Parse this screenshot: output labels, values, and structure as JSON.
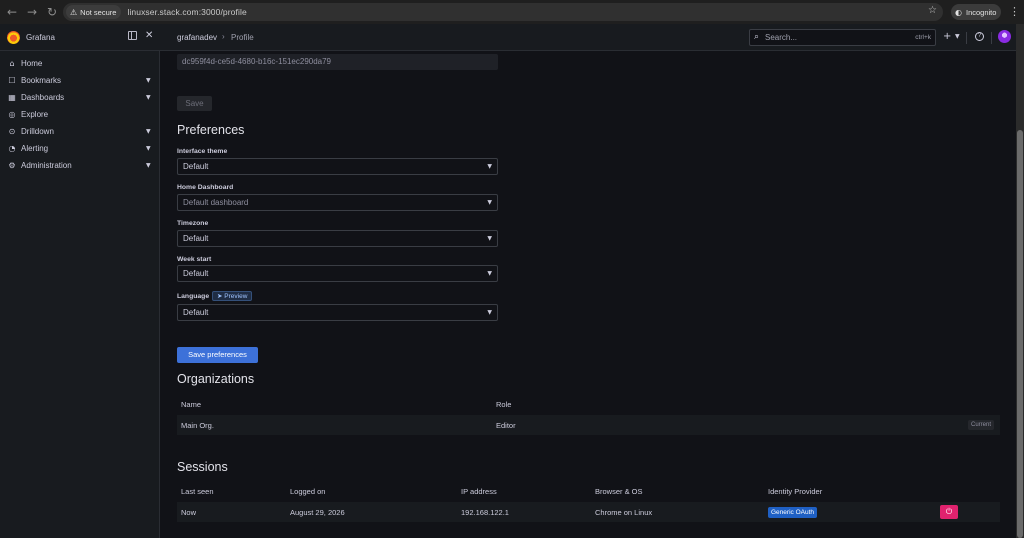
{
  "browser": {
    "back_icon": "arrow-left-icon",
    "forward_icon": "arrow-right-icon",
    "reload_icon": "reload-icon",
    "not_secure_label": "Not secure",
    "url": "linuxser.stack.com:3000/profile",
    "incognito_label": "Incognito"
  },
  "topbar": {
    "brand": "Grafana",
    "breadcrumb_root": "grafanadev",
    "breadcrumb_sep": "›",
    "breadcrumb_current": "Profile",
    "search_placeholder": "Search...",
    "search_shortcut": "ctrl+k",
    "plus_label": "+",
    "help_label": "?"
  },
  "sidebar": {
    "items": [
      {
        "label": "Home",
        "icon": "⌂",
        "has_chevron": false
      },
      {
        "label": "Bookmarks",
        "icon": "☐",
        "has_chevron": true
      },
      {
        "label": "Dashboards",
        "icon": "▦",
        "has_chevron": true
      },
      {
        "label": "Explore",
        "icon": "◎",
        "has_chevron": false
      },
      {
        "label": "Drilldown",
        "icon": "⊙",
        "has_chevron": true
      },
      {
        "label": "Alerting",
        "icon": "◔",
        "has_chevron": true
      },
      {
        "label": "Administration",
        "icon": "⚙",
        "has_chevron": true
      }
    ]
  },
  "profile": {
    "uid_value": "dc959f4d-ce5d-4680-b16c-151ec290da79",
    "save_label": "Save"
  },
  "preferences": {
    "title": "Preferences",
    "fields": [
      {
        "label": "Interface theme",
        "value": "Default"
      },
      {
        "label": "Home Dashboard",
        "value": "Default dashboard"
      },
      {
        "label": "Timezone",
        "value": "Default"
      },
      {
        "label": "Week start",
        "value": "Default"
      },
      {
        "label": "Language",
        "value": "Default"
      }
    ],
    "preview_badge": "Preview",
    "save_label": "Save preferences"
  },
  "organizations": {
    "title": "Organizations",
    "headers": [
      "Name",
      "Role"
    ],
    "rows": [
      {
        "name": "Main Org.",
        "role": "Editor",
        "tag": "Current"
      }
    ]
  },
  "sessions": {
    "title": "Sessions",
    "headers": [
      "Last seen",
      "Logged on",
      "IP address",
      "Browser & OS",
      "Identity Provider"
    ],
    "rows": [
      {
        "last_seen": "Now",
        "logged_on": "August 29, 2026",
        "ip": "192.168.122.1",
        "browser": "Chrome on Linux",
        "provider": "Generic OAuth"
      }
    ]
  }
}
